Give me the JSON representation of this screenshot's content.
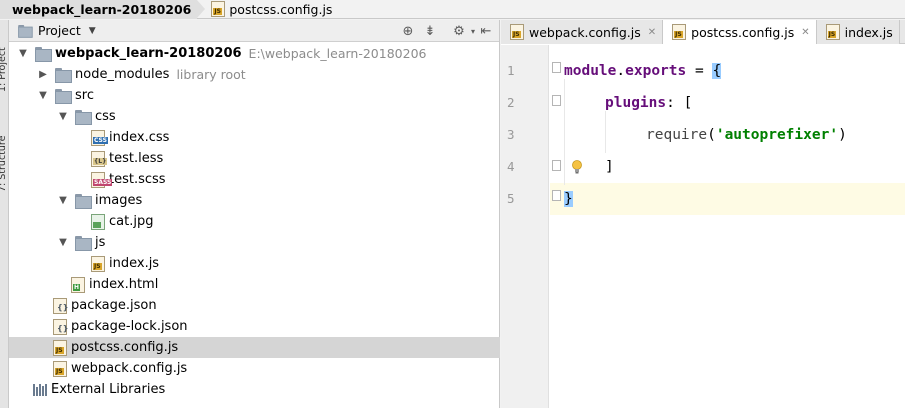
{
  "breadcrumb": {
    "project": "webpack_learn-20180206",
    "file": "postcss.config.js"
  },
  "tool_strip": {
    "project_tab": "1: Project",
    "structure_tab": "7: Structure"
  },
  "project_panel": {
    "title": "Project",
    "tree": [
      {
        "label": "webpack_learn-20180206",
        "hint": "E:\\webpack_learn-20180206",
        "icon": "folder-icon",
        "expanded": true
      },
      {
        "label": "node_modules",
        "hint": "library root",
        "icon": "folder-icon",
        "expanded": false
      },
      {
        "label": "src",
        "icon": "folder-icon",
        "expanded": true
      },
      {
        "label": "css",
        "icon": "folder-icon",
        "expanded": true
      },
      {
        "label": "index.css",
        "icon": "css-file-icon"
      },
      {
        "label": "test.less",
        "icon": "less-file-icon"
      },
      {
        "label": "test.scss",
        "icon": "sass-file-icon"
      },
      {
        "label": "images",
        "icon": "folder-icon",
        "expanded": true
      },
      {
        "label": "cat.jpg",
        "icon": "image-file-icon"
      },
      {
        "label": "js",
        "icon": "folder-icon",
        "expanded": true
      },
      {
        "label": "index.js",
        "icon": "js-file-icon"
      },
      {
        "label": "index.html",
        "icon": "html-file-icon"
      },
      {
        "label": "package.json",
        "icon": "json-file-icon"
      },
      {
        "label": "package-lock.json",
        "icon": "json-file-icon"
      },
      {
        "label": "postcss.config.js",
        "icon": "js-file-icon",
        "selected": true
      },
      {
        "label": "webpack.config.js",
        "icon": "js-file-icon"
      },
      {
        "label": "External Libraries",
        "icon": "libraries-icon"
      }
    ]
  },
  "editor": {
    "tabs": [
      {
        "label": "webpack.config.js",
        "active": false
      },
      {
        "label": "postcss.config.js",
        "active": true
      },
      {
        "label": "index.js",
        "active": false
      }
    ],
    "line_numbers": [
      "1",
      "2",
      "3",
      "4",
      "5"
    ],
    "code": {
      "l1_a": "module",
      "l1_b": ".",
      "l1_c": "exports",
      "l1_d": " = ",
      "l1_e": "{",
      "l2_a": "plugins",
      "l2_b": ": [",
      "l3_a": "require",
      "l3_b": "(",
      "l3_c": "'autoprefixer'",
      "l3_d": ")",
      "l4_a": "]",
      "l5_a": "}"
    },
    "current_line": 5,
    "colors": {
      "keyword": "#660e7a",
      "string": "#008000",
      "brace_match": "#99ccff",
      "current_line": "#fefbe4"
    }
  }
}
